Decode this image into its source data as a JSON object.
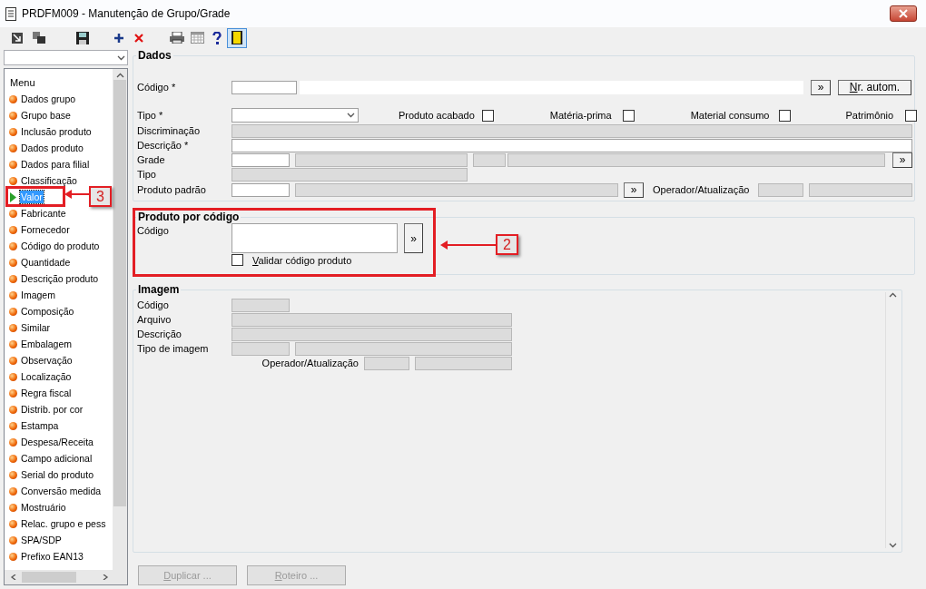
{
  "window": {
    "title": "PRDFM009 - Manutenção de Grupo/Grade"
  },
  "sidebar": {
    "menu_header": "Menu",
    "items": [
      {
        "label": "Dados grupo",
        "selected": false
      },
      {
        "label": "Grupo base",
        "selected": false
      },
      {
        "label": "Inclusão produto",
        "selected": false
      },
      {
        "label": "Dados produto",
        "selected": false
      },
      {
        "label": "Dados para filial",
        "selected": false
      },
      {
        "label": "Classificação",
        "selected": false
      },
      {
        "label": "Valor",
        "selected": true
      },
      {
        "label": "Fabricante",
        "selected": false
      },
      {
        "label": "Fornecedor",
        "selected": false
      },
      {
        "label": "Código do produto",
        "selected": false
      },
      {
        "label": "Quantidade",
        "selected": false
      },
      {
        "label": "Descrição produto",
        "selected": false
      },
      {
        "label": "Imagem",
        "selected": false
      },
      {
        "label": "Composição",
        "selected": false
      },
      {
        "label": "Similar",
        "selected": false
      },
      {
        "label": "Embalagem",
        "selected": false
      },
      {
        "label": "Observação",
        "selected": false
      },
      {
        "label": "Localização",
        "selected": false
      },
      {
        "label": "Regra fiscal",
        "selected": false
      },
      {
        "label": "Distrib. por cor",
        "selected": false
      },
      {
        "label": "Estampa",
        "selected": false
      },
      {
        "label": "Despesa/Receita",
        "selected": false
      },
      {
        "label": "Campo adicional",
        "selected": false
      },
      {
        "label": "Serial do produto",
        "selected": false
      },
      {
        "label": "Conversão medida",
        "selected": false
      },
      {
        "label": "Mostruário",
        "selected": false
      },
      {
        "label": "Relac. grupo e pess",
        "selected": false
      },
      {
        "label": "SPA/SDP",
        "selected": false
      },
      {
        "label": "Prefixo EAN13",
        "selected": false
      }
    ]
  },
  "dados": {
    "title": "Dados",
    "codigo_label": "Código *",
    "search_button": "»",
    "auto_number_button": "Nr. autom.",
    "tipo_label": "Tipo *",
    "flags": [
      {
        "label": "Produto acabado",
        "checked": false
      },
      {
        "label": "Matéria-prima",
        "checked": false
      },
      {
        "label": "Material consumo",
        "checked": false
      },
      {
        "label": "Patrimônio",
        "checked": false
      }
    ],
    "discriminacao_label": "Discriminação",
    "descricao_label": "Descrição *",
    "grade_label": "Grade",
    "grade_button": "»",
    "tipo2_label": "Tipo",
    "produto_padrao_label": "Produto padrão",
    "produto_padrao_button": "»",
    "operador_label": "Operador/Atualização"
  },
  "produto_por_codigo": {
    "title": "Produto por código",
    "codigo_label": "Código",
    "search_button": "»",
    "validate": {
      "label": "Validar código produto",
      "checked": false
    }
  },
  "imagem": {
    "title": "Imagem",
    "codigo_label": "Código",
    "arquivo_label": "Arquivo",
    "descricao_label": "Descrição",
    "tipo_label": "Tipo de imagem",
    "operador_label": "Operador/Atualização"
  },
  "buttons": [
    {
      "label": "Duplicar ...",
      "disabled": true
    },
    {
      "label": "Roteiro ...",
      "disabled": true
    }
  ],
  "annotations": [
    {
      "label": "3"
    },
    {
      "label": "2"
    }
  ]
}
